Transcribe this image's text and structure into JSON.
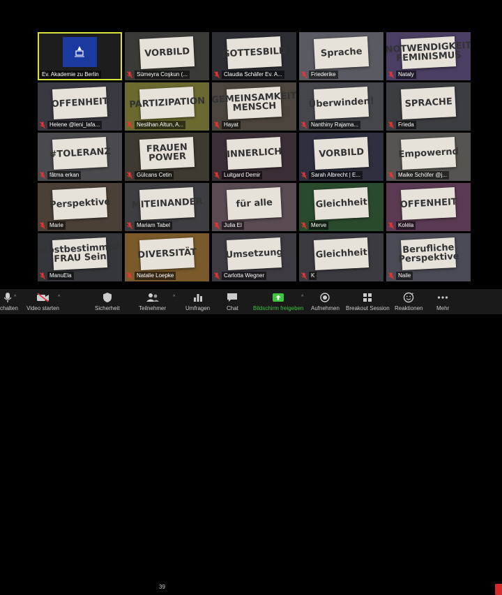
{
  "colors": {
    "active_border": "#d7e23a",
    "mute_red": "#e33",
    "share_green": "#3ec43e",
    "end_red": "#d12b2b"
  },
  "participants": [
    {
      "name": "Ev. Akademie zu Berlin",
      "sign": "",
      "bg": "#1d1d1d",
      "logo": true,
      "active": true,
      "muted": false
    },
    {
      "name": "Sümeyra Coşkun (...",
      "sign": "VORBILD",
      "bg": "#3a3a36",
      "muted": true
    },
    {
      "name": "Claudia Schäfer Ev. A...",
      "sign": "GOTTESBILD",
      "bg": "#2c2e34",
      "muted": true
    },
    {
      "name": "Friederike",
      "sign": "Sprache",
      "bg": "#5a5a62",
      "muted": true
    },
    {
      "name": "Nataly",
      "sign": "NOTWENDIGKEIT FEMINISMUS",
      "bg": "#4a3e62",
      "muted": true
    },
    {
      "name": "Helene @leni_lafa...",
      "sign": "OFFENHEIT",
      "bg": "#3a3840",
      "muted": true
    },
    {
      "name": "Neslihan Altun, A...",
      "sign": "PARTIZIPATION",
      "bg": "#6a6a30",
      "muted": true
    },
    {
      "name": "Hayat",
      "sign": "GEMEINSAMKEIT MENSCH",
      "bg": "#4a443c",
      "muted": true
    },
    {
      "name": "Nanthiny Rajama...",
      "sign": "Überwinden!",
      "bg": "#44464c",
      "muted": true
    },
    {
      "name": "Frieda",
      "sign": "SPRACHE",
      "bg": "#3c3d40",
      "muted": true
    },
    {
      "name": "fâtma erkan",
      "sign": "#TOLERANZ",
      "bg": "#4a4a4e",
      "muted": true
    },
    {
      "name": "Gülcans Cetin",
      "sign": "FRAUEN POWER",
      "bg": "#3e3a32",
      "muted": true
    },
    {
      "name": "Luitgard Demir",
      "sign": "INNERLICH",
      "bg": "#3a2e36",
      "muted": true
    },
    {
      "name": "Sarah Albrecht | E...",
      "sign": "VORBILD",
      "bg": "#2e3040",
      "muted": true
    },
    {
      "name": "Maike Schöfer @j...",
      "sign": "Empowernd",
      "bg": "#555450",
      "muted": true
    },
    {
      "name": "Marie",
      "sign": "Perspektive",
      "bg": "#4a4036",
      "muted": true
    },
    {
      "name": "Mariam Tabel",
      "sign": "MITEINANDER",
      "bg": "#3e3e42",
      "muted": true
    },
    {
      "name": "Julia El",
      "sign": "für alle",
      "bg": "#5a4a52",
      "muted": true
    },
    {
      "name": "Merve",
      "sign": "Gleichheit",
      "bg": "#2a4a2e",
      "muted": true
    },
    {
      "name": "Koléla",
      "sign": "OFFENHEIT",
      "bg": "#5a3a52",
      "muted": true
    },
    {
      "name": "ManuEla",
      "sign": "Selbstbestimmung FRAU Sein",
      "bg": "#34363a",
      "muted": true
    },
    {
      "name": "Natalie Loepke",
      "sign": "DIVERSITÄT",
      "bg": "#7a5a2a",
      "muted": true
    },
    {
      "name": "Carlotta Wegner",
      "sign": "Umsetzung",
      "bg": "#3e3a42",
      "muted": true
    },
    {
      "name": "K",
      "sign": "Gleichheit",
      "bg": "#3a3a40",
      "muted": true
    },
    {
      "name": "Naile",
      "sign": "Berufliche Perspektive",
      "bg": "#4a4a54",
      "muted": true
    }
  ],
  "toolbar": {
    "audio_label": "schalten",
    "video_label": "Video starten",
    "security_label": "Sicherheit",
    "participants_label": "Teilnehmer",
    "participants_count": "39",
    "polls_label": "Umfragen",
    "chat_label": "Chat",
    "share_label": "Bildschirm freigeben",
    "record_label": "Aufnehmen",
    "breakout_label": "Breakout Session",
    "reactions_label": "Reaktionen",
    "more_label": "Mehr"
  }
}
